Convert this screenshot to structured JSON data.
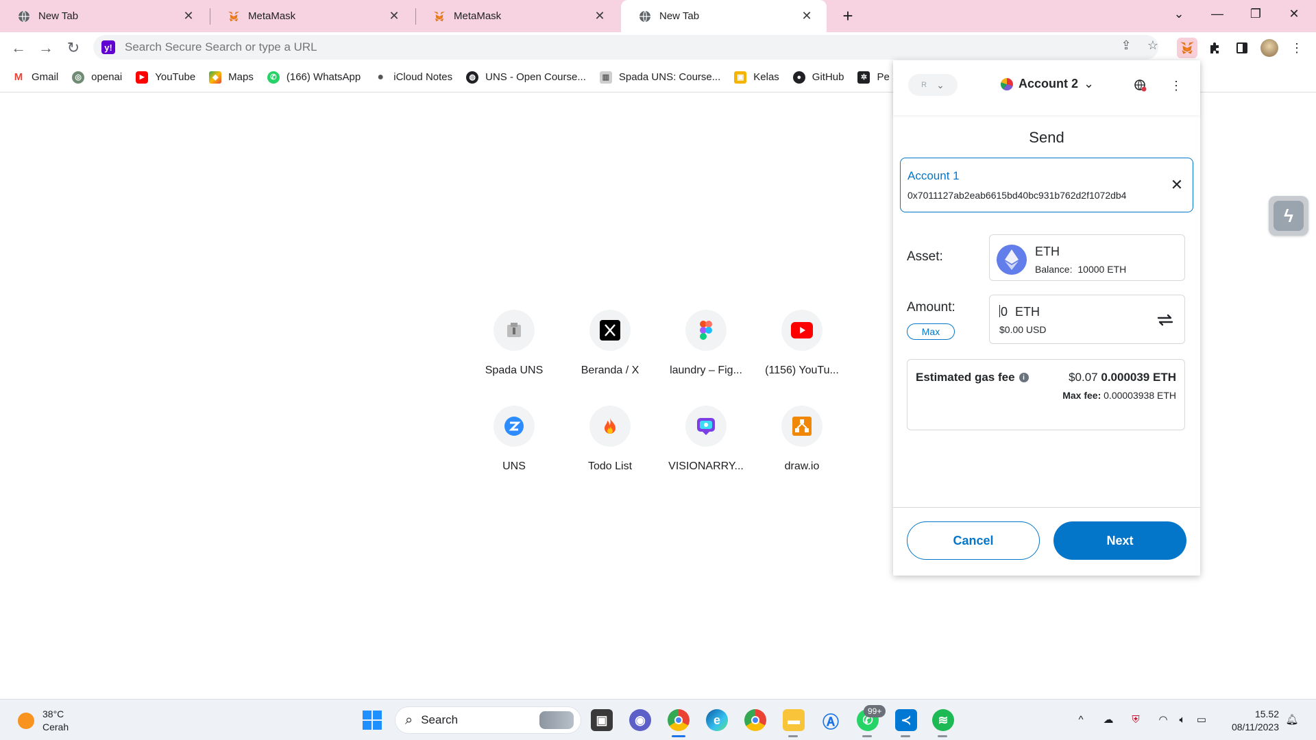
{
  "tabs": [
    {
      "title": "New Tab",
      "icon": "globe-icon"
    },
    {
      "title": "MetaMask",
      "icon": "metamask-fox-icon"
    },
    {
      "title": "MetaMask",
      "icon": "metamask-fox-icon"
    },
    {
      "title": "New Tab",
      "icon": "globe-icon",
      "active": true
    }
  ],
  "omnibox": {
    "placeholder": "Search Secure Search or type a URL"
  },
  "bookmarks": [
    {
      "label": "Gmail",
      "icon": "gmail-icon",
      "color": "#ea4335"
    },
    {
      "label": "openai",
      "icon": "openai-icon",
      "color": "#6e8b74"
    },
    {
      "label": "YouTube",
      "icon": "youtube-icon",
      "color": "#ff0000"
    },
    {
      "label": "Maps",
      "icon": "maps-icon",
      "color": "#34a853"
    },
    {
      "label": "(166) WhatsApp",
      "icon": "whatsapp-icon",
      "color": "#25d366"
    },
    {
      "label": "iCloud Notes",
      "icon": "apple-icon",
      "color": "#555555"
    },
    {
      "label": "UNS - Open Course...",
      "icon": "globe-icon",
      "color": "#202124"
    },
    {
      "label": "Spada UNS: Course...",
      "icon": "spada-icon",
      "color": "#888888"
    },
    {
      "label": "Kelas",
      "icon": "classroom-icon",
      "color": "#f4b400"
    },
    {
      "label": "GitHub",
      "icon": "github-icon",
      "color": "#202124"
    },
    {
      "label": "Pe",
      "icon": "pe-icon",
      "color": "#202124"
    }
  ],
  "shortcuts": [
    {
      "label": "Spada UNS",
      "icon": "spada-icon"
    },
    {
      "label": "Beranda / X",
      "icon": "x-logo-icon"
    },
    {
      "label": "laundry – Fig...",
      "icon": "figma-icon"
    },
    {
      "label": "(1156) YouTu...",
      "icon": "youtube-icon"
    },
    {
      "label": "UNS",
      "icon": "zoom-icon"
    },
    {
      "label": "Todo List",
      "icon": "flame-icon"
    },
    {
      "label": "VISIONARRY...",
      "icon": "visionarry-icon"
    },
    {
      "label": "draw.io",
      "icon": "drawio-icon"
    }
  ],
  "metamask": {
    "network_short": "R",
    "account_name": "Account 2",
    "title": "Send",
    "recipient": {
      "name": "Account 1",
      "address": "0x7011127ab2eab6615bd40bc931b762d2f1072db4"
    },
    "asset": {
      "label": "Asset:",
      "name": "ETH",
      "balance_label": "Balance:",
      "balance": "10000 ETH"
    },
    "amount": {
      "label": "Amount:",
      "value": "0",
      "unit": "ETH",
      "usd": "$0.00 USD",
      "max_label": "Max"
    },
    "gas": {
      "label": "Estimated gas fee",
      "fiat": "$0.07",
      "eth": "0.000039 ETH",
      "max_label": "Max fee:",
      "max_value": "0.00003938 ETH"
    },
    "cancel_label": "Cancel",
    "next_label": "Next",
    "colors": {
      "primary": "#0376c9",
      "border": "#d6d9dc",
      "text": "#24272a"
    }
  },
  "taskbar": {
    "temperature": "38°C",
    "weather": "Cerah",
    "search_label": "Search",
    "whatsapp_badge": "99+",
    "time": "15.52",
    "date": "08/11/2023"
  }
}
